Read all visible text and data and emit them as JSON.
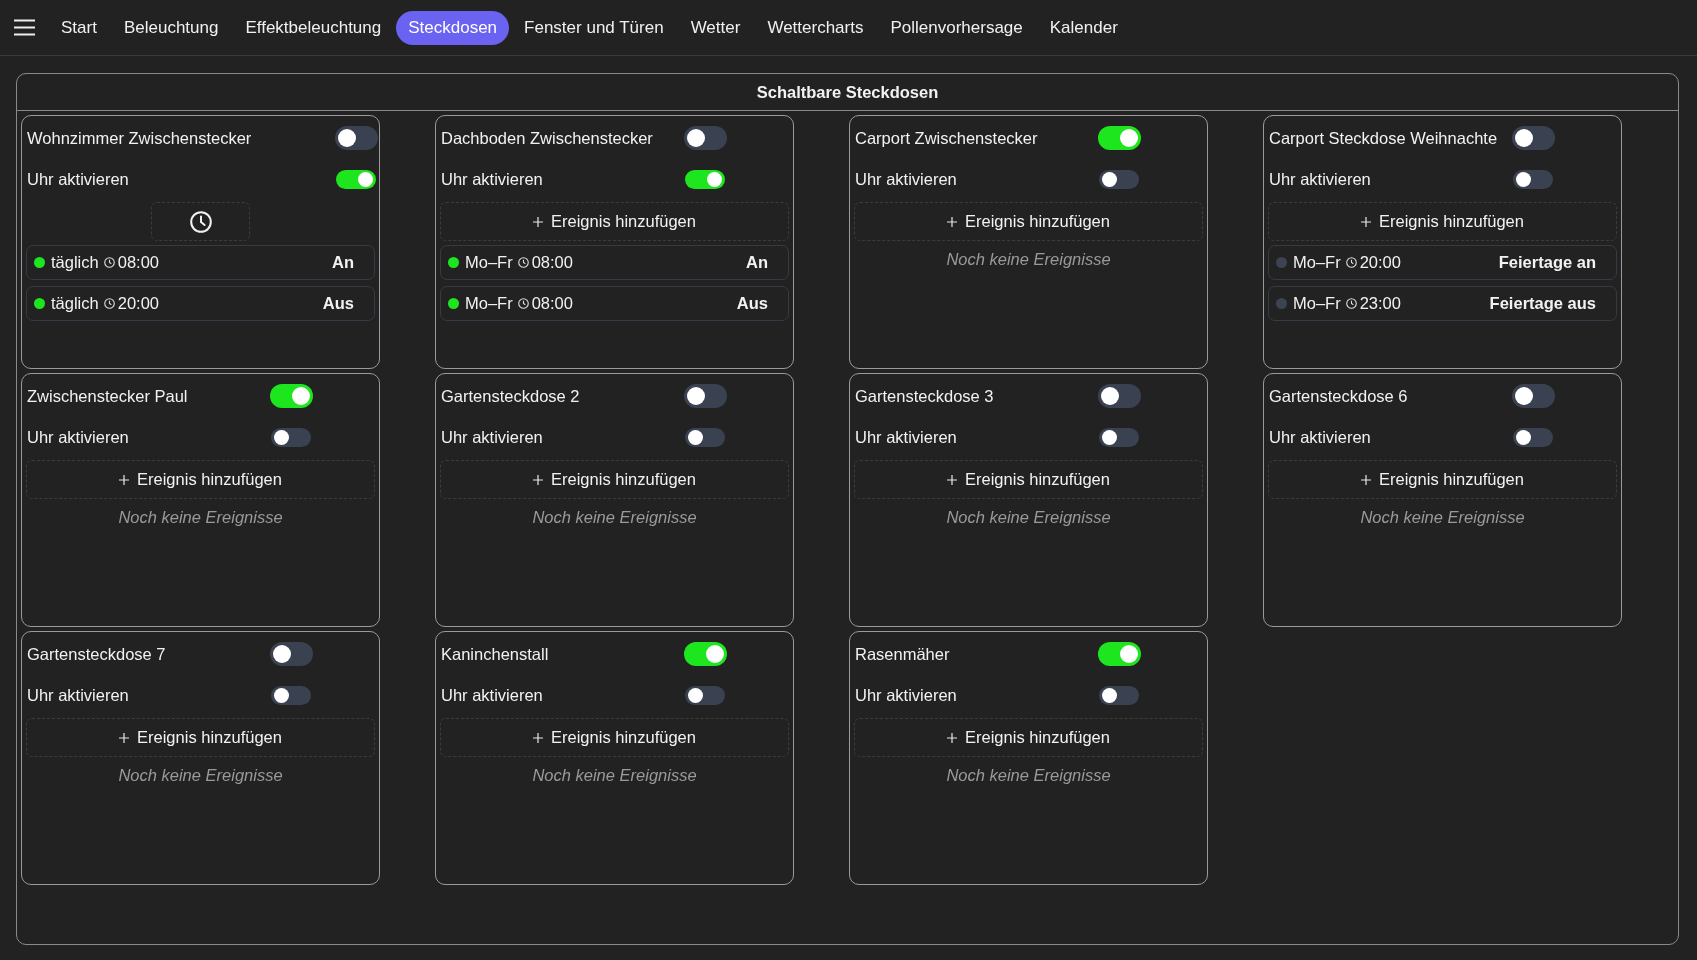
{
  "nav": {
    "items": [
      {
        "label": "Start",
        "selected": false
      },
      {
        "label": "Beleuchtung",
        "selected": false
      },
      {
        "label": "Effektbeleuchtung",
        "selected": false
      },
      {
        "label": "Steckdosen",
        "selected": true
      },
      {
        "label": "Fenster und Türen",
        "selected": false
      },
      {
        "label": "Wetter",
        "selected": false
      },
      {
        "label": "Wettercharts",
        "selected": false
      },
      {
        "label": "Pollenvorhersage",
        "selected": false
      },
      {
        "label": "Kalender",
        "selected": false
      }
    ]
  },
  "panel": {
    "title": "Schaltbare Steckdosen",
    "devices": [
      {
        "name": "Wohnzimmer Zwischenstecker",
        "on": false,
        "timer": {
          "label": "Uhr aktivieren",
          "on": true
        },
        "add": {
          "kind": "icon"
        },
        "events": [
          {
            "days": "täglich",
            "time": "08:00",
            "action": "An",
            "active": true
          },
          {
            "days": "täglich",
            "time": "20:00",
            "action": "Aus",
            "active": true
          }
        ]
      },
      {
        "name": "Dachboden Zwischenstecker",
        "on": false,
        "timer": {
          "label": "Uhr aktivieren",
          "on": true
        },
        "add": {
          "kind": "text",
          "label": "Ereignis hinzufügen"
        },
        "events": [
          {
            "days": "Mo–Fr",
            "time": "08:00",
            "action": "An",
            "active": true
          },
          {
            "days": "Mo–Fr",
            "time": "08:00",
            "action": "Aus",
            "active": true
          }
        ]
      },
      {
        "name": "Carport Zwischenstecker",
        "on": true,
        "timer": {
          "label": "Uhr aktivieren",
          "on": false
        },
        "add": {
          "kind": "text",
          "label": "Ereignis hinzufügen"
        },
        "empty_text": "Noch keine Ereignisse"
      },
      {
        "name": "Carport Steckdose Weihnachte",
        "on": false,
        "timer": {
          "label": "Uhr aktivieren",
          "on": false
        },
        "add": {
          "kind": "text",
          "label": "Ereignis hinzufügen"
        },
        "events": [
          {
            "days": "Mo–Fr",
            "time": "20:00",
            "action": "Feiertage an",
            "active": false
          },
          {
            "days": "Mo–Fr",
            "time": "23:00",
            "action": "Feiertage aus",
            "active": false
          }
        ]
      },
      {
        "name": "Zwischenstecker Paul",
        "on": true,
        "timer": {
          "label": "Uhr aktivieren",
          "on": false
        },
        "add": {
          "kind": "text",
          "label": "Ereignis hinzufügen"
        },
        "empty_text": "Noch keine Ereignisse"
      },
      {
        "name": "Gartensteckdose 2",
        "on": false,
        "timer": {
          "label": "Uhr aktivieren",
          "on": false
        },
        "add": {
          "kind": "text",
          "label": "Ereignis hinzufügen"
        },
        "empty_text": "Noch keine Ereignisse"
      },
      {
        "name": "Gartensteckdose 3",
        "on": false,
        "timer": {
          "label": "Uhr aktivieren",
          "on": false
        },
        "add": {
          "kind": "text",
          "label": "Ereignis hinzufügen"
        },
        "empty_text": "Noch keine Ereignisse"
      },
      {
        "name": "Gartensteckdose 6",
        "on": false,
        "timer": {
          "label": "Uhr aktivieren",
          "on": false
        },
        "add": {
          "kind": "text",
          "label": "Ereignis hinzufügen"
        },
        "empty_text": "Noch keine Ereignisse"
      },
      {
        "name": "Gartensteckdose 7",
        "on": false,
        "timer": {
          "label": "Uhr aktivieren",
          "on": false
        },
        "add": {
          "kind": "text",
          "label": "Ereignis hinzufügen"
        },
        "empty_text": "Noch keine Ereignisse"
      },
      {
        "name": "Kaninchenstall",
        "on": true,
        "timer": {
          "label": "Uhr aktivieren",
          "on": false
        },
        "add": {
          "kind": "text",
          "label": "Ereignis hinzufügen"
        },
        "empty_text": "Noch keine Ereignisse"
      },
      {
        "name": "Rasenmäher",
        "on": true,
        "timer": {
          "label": "Uhr aktivieren",
          "on": false
        },
        "add": {
          "kind": "text",
          "label": "Ereignis hinzufügen"
        },
        "empty_text": "Noch keine Ereignisse"
      }
    ]
  }
}
